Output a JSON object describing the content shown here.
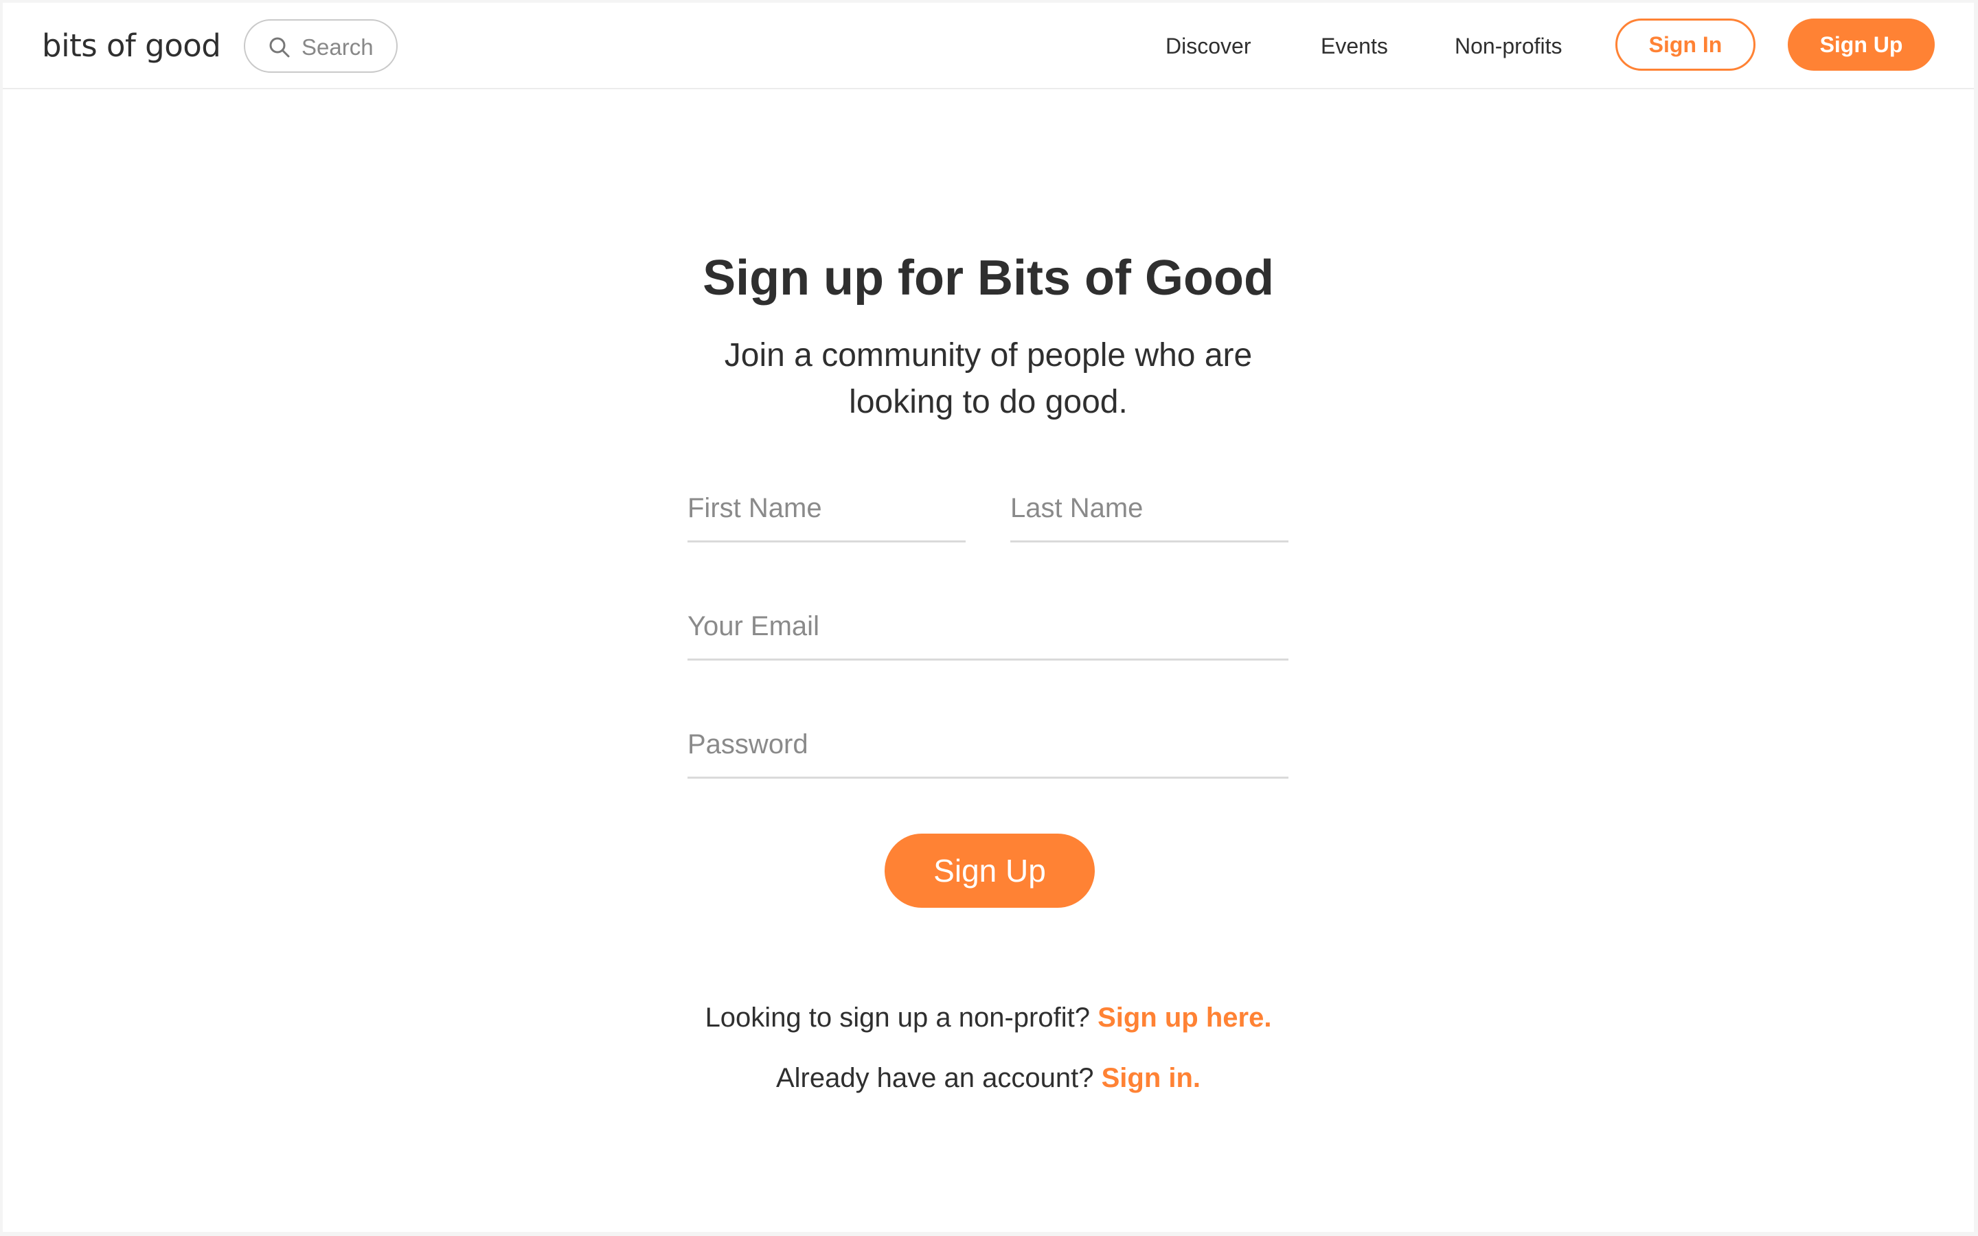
{
  "header": {
    "logo": "bits of good",
    "search_placeholder": "Search",
    "nav": [
      "Discover",
      "Events",
      "Non-profits"
    ],
    "sign_in_label": "Sign In",
    "sign_up_label": "Sign Up"
  },
  "main": {
    "title": "Sign up for Bits of Good",
    "subtitle": "Join a community of people who are looking to do good.",
    "fields": {
      "first_name": "First Name",
      "last_name": "Last Name",
      "email": "Your Email",
      "password": "Password"
    },
    "submit_label": "Sign Up",
    "nonprofit_prompt": "Looking to sign up a non-profit?",
    "nonprofit_link": "Sign up here.",
    "account_prompt": "Already have an account?",
    "account_link": "Sign in."
  },
  "colors": {
    "accent": "#ff8234",
    "text": "#2f2f2f",
    "placeholder": "#8a8a8a"
  },
  "icons": {
    "search": "search-icon"
  }
}
